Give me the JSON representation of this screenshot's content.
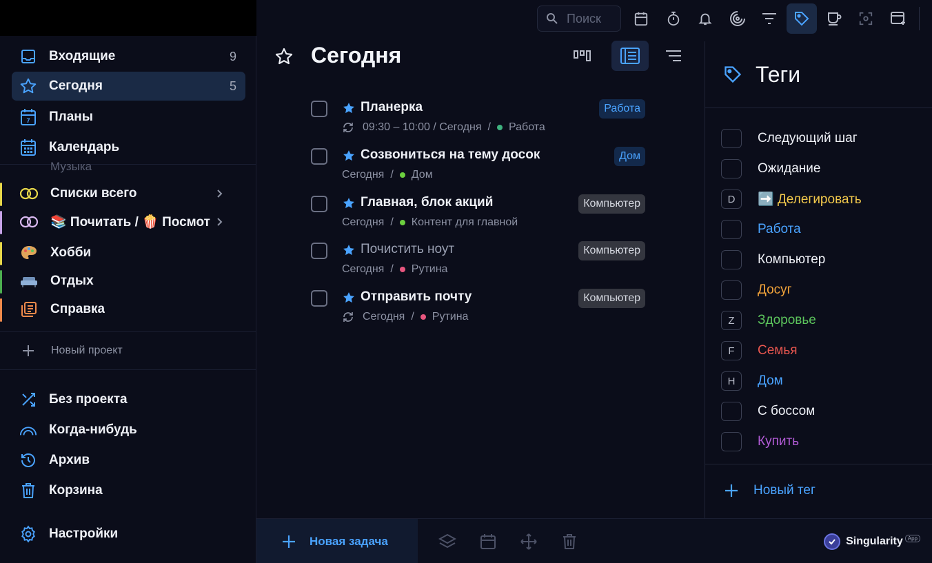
{
  "sidebar": {
    "nav": [
      {
        "label": "Входящие",
        "count": "9"
      },
      {
        "label": "Сегодня",
        "count": "5"
      },
      {
        "label": "Планы",
        "count": ""
      },
      {
        "label": "Календарь",
        "count": ""
      }
    ],
    "calendar_day": "7",
    "ghost_item": "Музыка",
    "projects": [
      {
        "label": "Списки всего",
        "color": "#e8d84a"
      },
      {
        "label": "📚 Почитать / 🍿 Посмотреть",
        "color": "#c7a3e8"
      },
      {
        "label": "Хобби",
        "color": "#e8d84a",
        "icon": "🎨"
      },
      {
        "label": "Отдых",
        "color": "#4caf50",
        "icon": "🛋️"
      },
      {
        "label": "Справка",
        "color": "#f08a4b"
      }
    ],
    "new_project": "Новый проект",
    "bottom": [
      {
        "label": "Без проекта"
      },
      {
        "label": "Когда-нибудь"
      },
      {
        "label": "Архив"
      },
      {
        "label": "Корзина"
      }
    ],
    "settings": "Настройки"
  },
  "toolbar": {
    "search_placeholder": "Поиск"
  },
  "main": {
    "title": "Сегодня",
    "tasks": [
      {
        "title": "Планерка",
        "time": "09:30 – 10:00 / Сегодня",
        "project": "Работа",
        "dot": "#3fb27f",
        "tag": "Работа",
        "tag_style": "blue",
        "repeat": true,
        "dim": false
      },
      {
        "title": "Созвониться на тему досок",
        "time": "Сегодня",
        "project": "Дом",
        "dot": "#6ccf3f",
        "tag": "Дом",
        "tag_style": "blue",
        "repeat": false,
        "dim": false
      },
      {
        "title": "Главная, блок акций",
        "time": "Сегодня",
        "project": "Контент для главной",
        "dot": "#6ccf3f",
        "tag": "Компьютер",
        "tag_style": "gray",
        "repeat": false,
        "dim": false
      },
      {
        "title": "Почистить ноут",
        "time": "Сегодня",
        "project": "Рутина",
        "dot": "#e8567f",
        "tag": "Компьютер",
        "tag_style": "gray",
        "repeat": false,
        "dim": true
      },
      {
        "title": "Отправить почту",
        "time": "Сегодня",
        "project": "Рутина",
        "dot": "#e8567f",
        "tag": "Компьютер",
        "tag_style": "gray",
        "repeat": true,
        "dim": false
      }
    ]
  },
  "tags_panel": {
    "title": "Теги",
    "tags": [
      {
        "key": "",
        "name": "Следующий шаг",
        "color": "#eef0f6"
      },
      {
        "key": "",
        "name": "Ожидание",
        "color": "#eef0f6"
      },
      {
        "key": "D",
        "name": "➡️ Делегировать",
        "color": "#f2c94c"
      },
      {
        "key": "",
        "name": "Работа",
        "color": "#4aa3ff"
      },
      {
        "key": "",
        "name": "Компьютер",
        "color": "#eef0f6"
      },
      {
        "key": "",
        "name": "Досуг",
        "color": "#f2a33a"
      },
      {
        "key": "Z",
        "name": "Здоровье",
        "color": "#5cc45c"
      },
      {
        "key": "F",
        "name": "Семья",
        "color": "#e8564f"
      },
      {
        "key": "H",
        "name": "Дом",
        "color": "#4aa3ff"
      },
      {
        "key": "",
        "name": "С боссом",
        "color": "#eef0f6"
      },
      {
        "key": "",
        "name": "Купить",
        "color": "#b25bd6"
      }
    ],
    "new_tag": "Новый тег"
  },
  "bottombar": {
    "new_task": "Новая задача",
    "brand": "Singularity",
    "brand_badge": "App"
  },
  "colors": {
    "accent": "#4aa3ff",
    "background": "#0b0d1a",
    "active_bg": "#1a2a45"
  }
}
